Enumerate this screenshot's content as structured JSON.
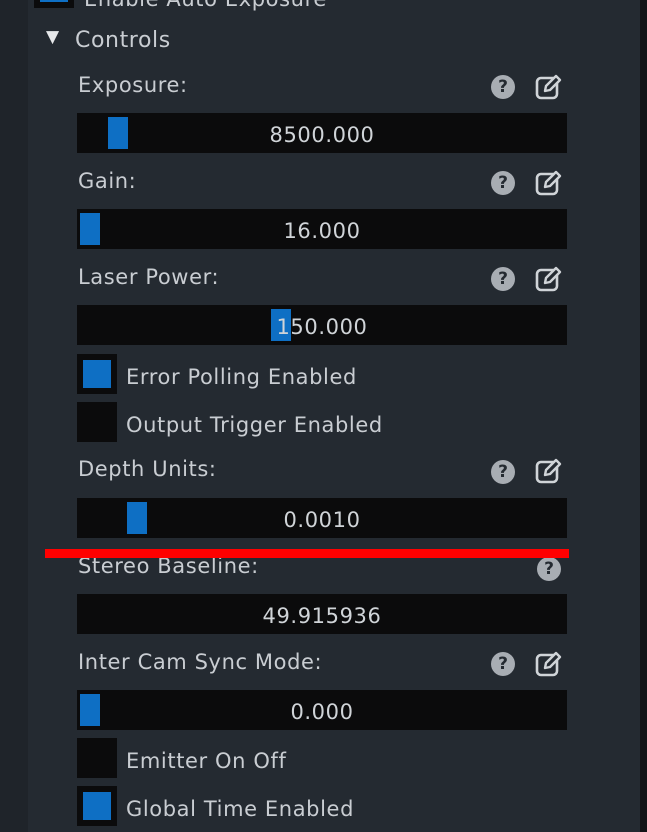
{
  "header": {
    "partial_checkbox_label": "Enable Auto Exposure"
  },
  "section": {
    "toggle_glyph": "▼",
    "title": "Controls"
  },
  "controls": {
    "exposure": {
      "label": "Exposure:",
      "value": "8500.000",
      "fill": 0.06
    },
    "gain": {
      "label": "Gain:",
      "value": "16.000",
      "fill": 0.0
    },
    "laser_power": {
      "label": "Laser Power:",
      "value": "150.000",
      "fill": 0.41
    },
    "error_polling": {
      "label": "Error Polling Enabled",
      "checked": true
    },
    "output_trigger": {
      "label": "Output Trigger Enabled",
      "checked": false
    },
    "depth_units": {
      "label": "Depth Units:",
      "value": "0.0010",
      "fill": 0.1
    },
    "stereo_baseline": {
      "label": "Stereo Baseline:",
      "value": "49.915936"
    },
    "inter_cam_sync": {
      "label": "Inter Cam Sync Mode:",
      "value": "0.000",
      "fill": 0.0
    },
    "emitter_on_off": {
      "label": "Emitter On Off",
      "checked": false
    },
    "global_time": {
      "label": "Global Time Enabled",
      "checked": true
    }
  },
  "icons": {
    "help": "question-circle-icon",
    "help_glyph": "?",
    "edit": "pencil-square-icon"
  },
  "colors": {
    "panel_bg": "#242a31",
    "field_bg": "#0b0b0c",
    "accent": "#0e6fc4",
    "text": "#c9cdd2",
    "annotation": "#ff0000"
  }
}
